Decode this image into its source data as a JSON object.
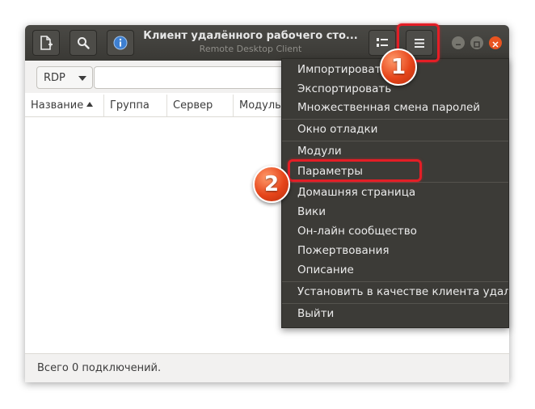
{
  "window": {
    "title": "Клиент удалённого рабочего сто...",
    "subtitle": "Remote Desktop Client"
  },
  "toolbar": {
    "protocol": "RDP",
    "search_value": ""
  },
  "table": {
    "columns": [
      "Название",
      "Группа",
      "Сервер",
      "Модуль"
    ]
  },
  "status": {
    "text": "Всего 0 подключений."
  },
  "menu": {
    "items": [
      "Импортировать",
      "Экспортировать",
      "Множественная смена паролей",
      "Окно отладки",
      "Модули",
      "Параметры",
      "Домашняя страница",
      "Вики",
      "Он-лайн сообщество",
      "Пожертвования",
      "Описание",
      "Установить в качестве клиента удалённого рабочего стола",
      "Выйти"
    ]
  },
  "annotations": {
    "badge_1": "1",
    "badge_2": "2",
    "highlight_color": "#e41e26"
  },
  "icons": [
    "new-connection-icon",
    "search-icon",
    "info-icon",
    "list-view-icon",
    "hamburger-menu-icon",
    "minimize-icon",
    "maximize-icon",
    "close-icon",
    "sort-ascending-icon"
  ]
}
